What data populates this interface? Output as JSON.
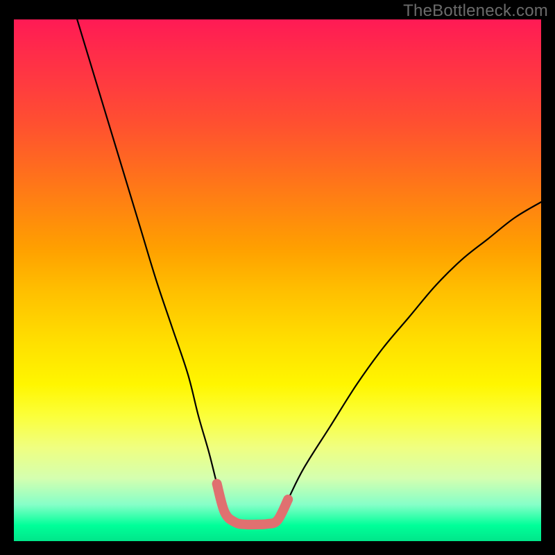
{
  "watermark": "TheBottleneck.com",
  "chart_data": {
    "type": "line",
    "title": "",
    "xlabel": "",
    "ylabel": "",
    "xlim": [
      0,
      100
    ],
    "ylim": [
      0,
      100
    ],
    "grid": false,
    "legend": false,
    "background_gradient": {
      "top_color": "#ff1a55",
      "bottom_color": "#00e68a"
    },
    "series": [
      {
        "name": "curve",
        "stroke": "#000000",
        "x": [
          12,
          15,
          18,
          21,
          24,
          27,
          30,
          33,
          35,
          37,
          38.5,
          40,
          42,
          44,
          46,
          48,
          50,
          52,
          55,
          60,
          65,
          70,
          75,
          80,
          85,
          90,
          95,
          100
        ],
        "y": [
          100,
          90,
          80,
          70,
          60,
          50,
          41,
          32,
          24,
          17,
          11,
          5.5,
          3.6,
          3.2,
          3.2,
          3.3,
          4.0,
          8,
          14,
          22,
          30,
          37,
          43,
          49,
          54,
          58,
          62,
          65
        ]
      },
      {
        "name": "highlight",
        "stroke": "#e07070",
        "x": [
          38.5,
          40,
          42,
          44,
          46,
          48,
          50,
          52
        ],
        "y": [
          11,
          5.5,
          3.6,
          3.2,
          3.2,
          3.3,
          4.0,
          8
        ]
      }
    ]
  }
}
